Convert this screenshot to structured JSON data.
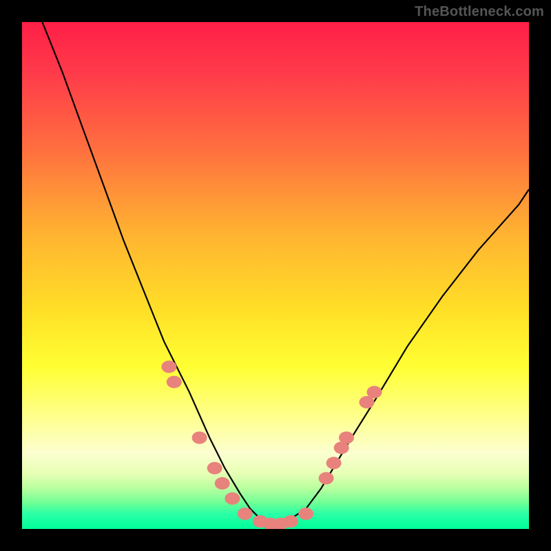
{
  "watermark": "TheBottleneck.com",
  "colors": {
    "frame": "#000000",
    "curve": "#000000",
    "dot_fill": "#e8827d",
    "dot_stroke": "#c46763"
  },
  "chart_data": {
    "type": "line",
    "title": "",
    "xlabel": "",
    "ylabel": "",
    "xlim": [
      0,
      100
    ],
    "ylim": [
      0,
      100
    ],
    "notes": "Bottleneck-style V-curve; vertical axis maps to color gradient (red=high bottleneck, green=0). No numeric tick labels are rendered in the image; values below are estimated from pixel positions. Marker dots cluster near the valley.",
    "series": [
      {
        "name": "bottleneck-curve",
        "x": [
          4,
          8,
          12,
          16,
          20,
          24,
          28,
          33,
          37,
          40,
          43,
          45,
          47,
          49,
          51,
          53,
          56,
          59,
          62,
          65,
          70,
          76,
          83,
          90,
          98,
          100
        ],
        "y": [
          100,
          90,
          79,
          68,
          57,
          47,
          37,
          27,
          18,
          12,
          7,
          4,
          2,
          1,
          1,
          2,
          4,
          8,
          13,
          18,
          26,
          36,
          46,
          55,
          64,
          67
        ]
      }
    ],
    "markers": [
      {
        "x": 29,
        "y": 32
      },
      {
        "x": 30,
        "y": 29
      },
      {
        "x": 35,
        "y": 18
      },
      {
        "x": 38,
        "y": 12
      },
      {
        "x": 39.5,
        "y": 9
      },
      {
        "x": 41.5,
        "y": 6
      },
      {
        "x": 44,
        "y": 3
      },
      {
        "x": 47,
        "y": 1.5
      },
      {
        "x": 49,
        "y": 1
      },
      {
        "x": 51,
        "y": 1
      },
      {
        "x": 53,
        "y": 1.5
      },
      {
        "x": 56,
        "y": 3
      },
      {
        "x": 60,
        "y": 10
      },
      {
        "x": 61.5,
        "y": 13
      },
      {
        "x": 63,
        "y": 16
      },
      {
        "x": 64,
        "y": 18
      },
      {
        "x": 68,
        "y": 25
      },
      {
        "x": 69.5,
        "y": 27
      }
    ]
  }
}
